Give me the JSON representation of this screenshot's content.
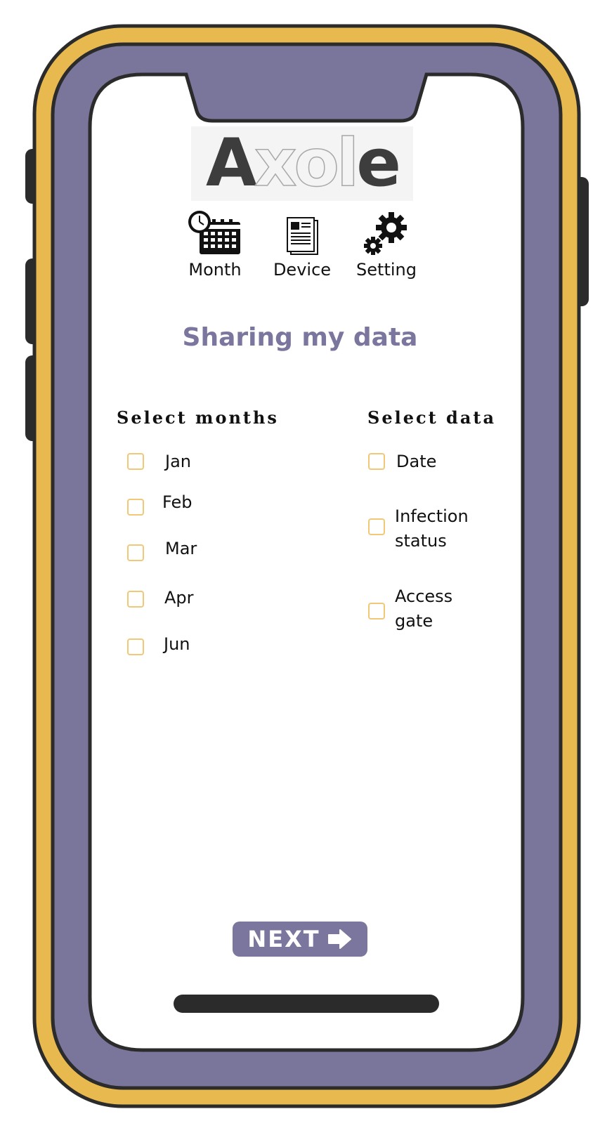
{
  "colors": {
    "frame_outer": "#e8b94f",
    "frame_inner": "#79759b",
    "outline": "#2b2b2b",
    "accent": "#7b769e",
    "checkbox_border": "#f0c878"
  },
  "app": {
    "logo_text": "Axole"
  },
  "nav": {
    "items": [
      {
        "label": "Month",
        "icon": "calendar-clock-icon"
      },
      {
        "label": "Device",
        "icon": "document-icon"
      },
      {
        "label": "Setting",
        "icon": "gears-icon"
      }
    ]
  },
  "page": {
    "title": "Sharing my data"
  },
  "months": {
    "heading": "Select months",
    "options": [
      {
        "label": "Jan",
        "checked": false
      },
      {
        "label": "Feb",
        "checked": false
      },
      {
        "label": "Mar",
        "checked": false
      },
      {
        "label": "Apr",
        "checked": false
      },
      {
        "label": "Jun",
        "checked": false
      }
    ]
  },
  "data_types": {
    "heading": "Select data",
    "options": [
      {
        "label_line1": "Date",
        "label_line2": "",
        "checked": false
      },
      {
        "label_line1": "Infection",
        "label_line2": "status",
        "checked": false
      },
      {
        "label_line1": "Access",
        "label_line2": "gate",
        "checked": false
      }
    ]
  },
  "actions": {
    "next_label": "NEXT",
    "next_icon": "arrow-right-icon"
  }
}
